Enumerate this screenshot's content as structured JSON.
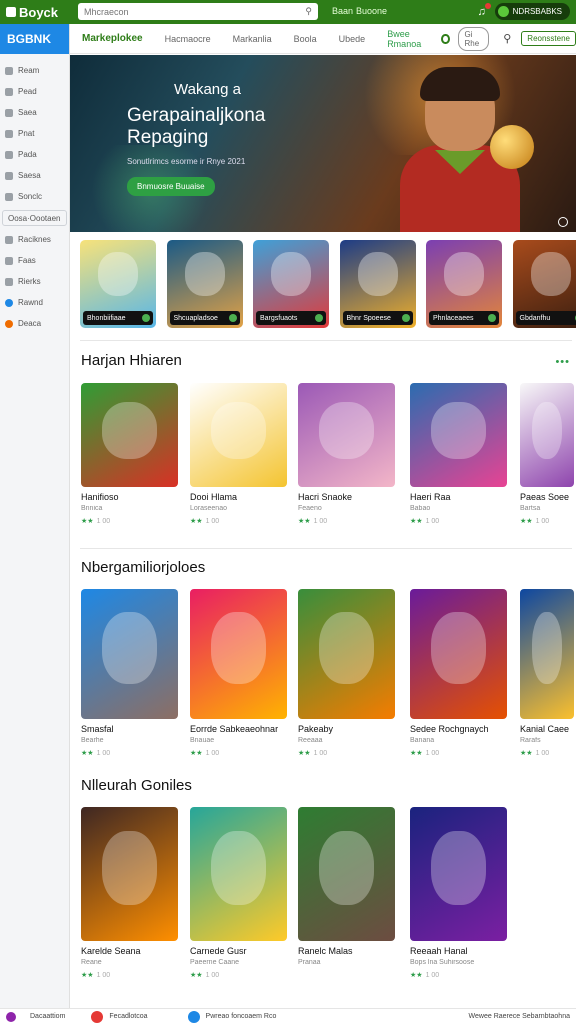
{
  "topbar": {
    "brand": "Boyck",
    "search_placeholder": "Mhcraecon",
    "link1": "Baan",
    "link2": "Buoone",
    "user": "NDRSBABKS"
  },
  "sidebar": {
    "header": "BGBNK",
    "items": [
      {
        "label": "Ream"
      },
      {
        "label": "Pead"
      },
      {
        "label": "Saea"
      },
      {
        "label": "Pnat"
      },
      {
        "label": "Pada"
      },
      {
        "label": "Saesa"
      },
      {
        "label": "Sonclc"
      },
      {
        "label": "Oosa·Oootaen"
      },
      {
        "label": "Raciknes"
      },
      {
        "label": "Faas"
      },
      {
        "label": "Rierks"
      },
      {
        "label": "Rawnd"
      },
      {
        "label": "Deaca"
      }
    ]
  },
  "nav": {
    "tabs": [
      "Markeplokee",
      "Hacmaocre",
      "Markanlia",
      "Boola",
      "Ubede",
      "Bwee Rmanoa"
    ],
    "pill": "Gi Rhe",
    "cta": "Reonsstene"
  },
  "hero": {
    "title_small": "Wakang a",
    "title_big": "Gerapainaljkona Repaging",
    "subtitle": "Sonutlrimcs esorme ir Rnye 2021",
    "cta": "Bnmuosre Buuaise"
  },
  "strip": [
    {
      "label": "Bhonbiifiaae",
      "colors": [
        "#f7e27a",
        "#57b6e8"
      ]
    },
    {
      "label": "Shcuapladsoe",
      "colors": [
        "#1b5a86",
        "#e2a246"
      ]
    },
    {
      "label": "Bargsfuaots",
      "colors": [
        "#3fa0d8",
        "#e23a3a"
      ]
    },
    {
      "label": "Bhnr Spoeese",
      "colors": [
        "#1d3c86",
        "#f0b02a"
      ]
    },
    {
      "label": "Phnlaceaees",
      "colors": [
        "#7b3fb2",
        "#e3853a"
      ]
    },
    {
      "label": "Gbdanfhu",
      "colors": [
        "#a84b1c",
        "#3b1f10"
      ]
    }
  ],
  "sections": [
    {
      "title": "Harjan Hhiaren",
      "more": "•••",
      "cards": [
        {
          "name": "Hanifioso",
          "meta": "Bnnica",
          "rating": "★★",
          "count": "1 00",
          "colors": [
            "#2f9d35",
            "#d93025"
          ]
        },
        {
          "name": "Dooi Hlama",
          "meta": "Loraseenao",
          "rating": "★★",
          "count": "1 00",
          "colors": [
            "#ffffff",
            "#f4c430"
          ]
        },
        {
          "name": "Hacri Snaoke",
          "meta": "Feaeno",
          "rating": "★★",
          "count": "1 00",
          "colors": [
            "#9b59b6",
            "#f3b6c8"
          ]
        },
        {
          "name": "Haeri Raa",
          "meta": "Babao",
          "rating": "★★",
          "count": "1 00",
          "colors": [
            "#2b6cb0",
            "#e84393"
          ]
        },
        {
          "name": "Paeas Soee",
          "meta": "Bartsa",
          "rating": "★★",
          "count": "1 00",
          "colors": [
            "#f8f8f8",
            "#8e44ad"
          ]
        }
      ]
    },
    {
      "title": "Nbergamiliorjoloes",
      "more": "",
      "cards": [
        {
          "name": "Smasfal",
          "meta": "Bearhe",
          "rating": "★★",
          "count": "1 00",
          "colors": [
            "#1e88e5",
            "#8d6e63"
          ]
        },
        {
          "name": "Eorrde Sabkeaeohnar",
          "meta": "Bnauae",
          "rating": "★★",
          "count": "1 00",
          "colors": [
            "#e91e63",
            "#ffb300"
          ]
        },
        {
          "name": "Pakeaby",
          "meta": "Reeaaa",
          "rating": "★★",
          "count": "1 00",
          "colors": [
            "#388e3c",
            "#f57c00"
          ]
        },
        {
          "name": "Sedee Rochgnaych",
          "meta": "Banana",
          "rating": "★★",
          "count": "1 00",
          "colors": [
            "#6a1b9a",
            "#e65100"
          ]
        },
        {
          "name": "Kanial Caee",
          "meta": "Rarafs",
          "rating": "★★",
          "count": "1 00",
          "colors": [
            "#0d47a1",
            "#fbc02d"
          ]
        }
      ]
    },
    {
      "title": "Nlleurah Goniles",
      "more": "",
      "cards": [
        {
          "name": "Karelde Seana",
          "meta": "Reane",
          "rating": "★★",
          "count": "1 00",
          "colors": [
            "#3e2723",
            "#ff8f00"
          ]
        },
        {
          "name": "Carnede Gusr",
          "meta": "Paeerne Caane",
          "rating": "★★",
          "count": "1 00",
          "colors": [
            "#26a69a",
            "#ffca28"
          ]
        },
        {
          "name": "Ranelc Malas",
          "meta": "Pranaa",
          "rating": "",
          "count": "",
          "colors": [
            "#2e7d32",
            "#6d4c41"
          ]
        },
        {
          "name": "Reeaah Hanal",
          "meta": "Bops lna Suhirsoose",
          "rating": "★★",
          "count": "1 00",
          "colors": [
            "#1a237e",
            "#7b1fa2"
          ]
        }
      ]
    }
  ],
  "bottom": {
    "t1": "Dacaattiom",
    "t2": "Fecadlotcoa",
    "t3": "Pwreao foncoaem Rco",
    "t4": "Wewee Raerece Sebarnbtaohna"
  }
}
